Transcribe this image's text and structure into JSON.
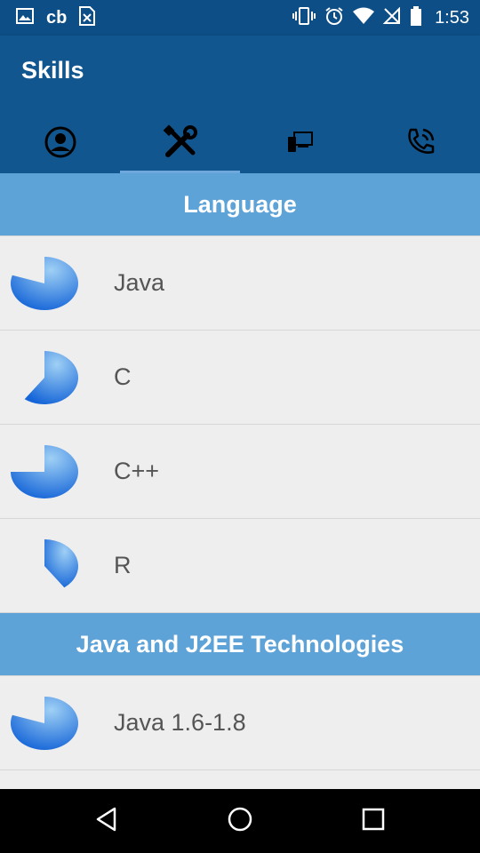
{
  "status_bar": {
    "icons_left": [
      "image-icon",
      "cb-icon",
      "document-x-icon"
    ],
    "cb_text": "cb",
    "icons_right": [
      "vibrate-icon",
      "alarm-icon",
      "wifi-icon",
      "no-sim-icon",
      "battery-icon"
    ],
    "time": "1:53"
  },
  "app_bar": {
    "title": "Skills",
    "tabs": [
      {
        "icon": "person-icon",
        "selected": false
      },
      {
        "icon": "tools-icon",
        "selected": true
      },
      {
        "icon": "devices-icon",
        "selected": false
      },
      {
        "icon": "phone-icon",
        "selected": false
      }
    ]
  },
  "sections": [
    {
      "title": "Language",
      "items": [
        {
          "label": "Java",
          "level": 0.8
        },
        {
          "label": "C",
          "level": 0.6
        },
        {
          "label": "C++",
          "level": 0.75
        },
        {
          "label": "R",
          "level": 0.4
        }
      ]
    },
    {
      "title": "Java and J2EE Technologies",
      "items": [
        {
          "label": "Java 1.6-1.8",
          "level": 0.8
        }
      ]
    }
  ],
  "nav_bar": {
    "icons": [
      "back-icon",
      "home-icon",
      "recents-icon"
    ]
  },
  "colors": {
    "status_bar": "#0d4e86",
    "app_bar": "#11568f",
    "section_header": "#5ea3d8",
    "list_bg": "#eeeeee",
    "chart_light": "#9fd0f5",
    "chart_dark": "#1565d8"
  }
}
